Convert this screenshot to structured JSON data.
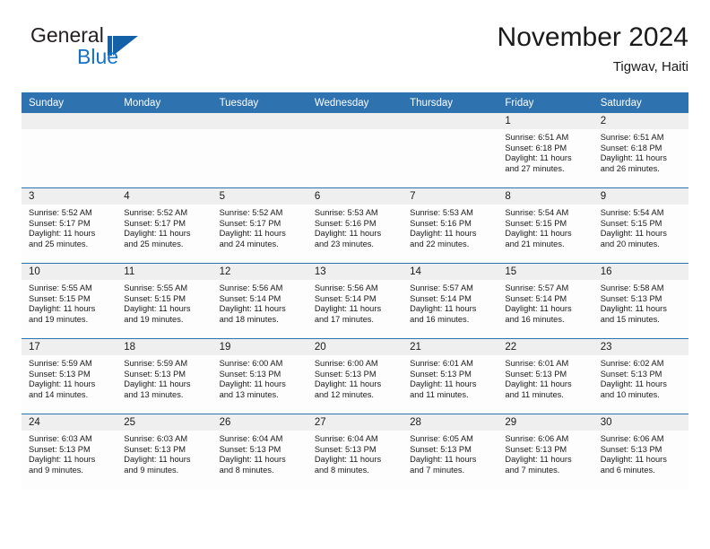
{
  "logo": {
    "text_top": "General",
    "text_bottom": "Blue",
    "mark": "blue-triangle-logo-icon",
    "color": "#1572c6"
  },
  "header": {
    "title": "November 2024",
    "subtitle": "Tigwav, Haiti"
  },
  "theme": {
    "header_blue": "#2e72b0",
    "daynum_band": "#efefef",
    "text": "#1a1a1a"
  },
  "calendar": {
    "weekday_headers": [
      "Sunday",
      "Monday",
      "Tuesday",
      "Wednesday",
      "Thursday",
      "Friday",
      "Saturday"
    ],
    "weeks": [
      [
        {
          "day": "",
          "lines": []
        },
        {
          "day": "",
          "lines": []
        },
        {
          "day": "",
          "lines": []
        },
        {
          "day": "",
          "lines": []
        },
        {
          "day": "",
          "lines": []
        },
        {
          "day": "1",
          "lines": [
            "Sunrise: 6:51 AM",
            "Sunset: 6:18 PM",
            "Daylight: 11 hours",
            "and 27 minutes."
          ]
        },
        {
          "day": "2",
          "lines": [
            "Sunrise: 6:51 AM",
            "Sunset: 6:18 PM",
            "Daylight: 11 hours",
            "and 26 minutes."
          ]
        }
      ],
      [
        {
          "day": "3",
          "lines": [
            "Sunrise: 5:52 AM",
            "Sunset: 5:17 PM",
            "Daylight: 11 hours",
            "and 25 minutes."
          ]
        },
        {
          "day": "4",
          "lines": [
            "Sunrise: 5:52 AM",
            "Sunset: 5:17 PM",
            "Daylight: 11 hours",
            "and 25 minutes."
          ]
        },
        {
          "day": "5",
          "lines": [
            "Sunrise: 5:52 AM",
            "Sunset: 5:17 PM",
            "Daylight: 11 hours",
            "and 24 minutes."
          ]
        },
        {
          "day": "6",
          "lines": [
            "Sunrise: 5:53 AM",
            "Sunset: 5:16 PM",
            "Daylight: 11 hours",
            "and 23 minutes."
          ]
        },
        {
          "day": "7",
          "lines": [
            "Sunrise: 5:53 AM",
            "Sunset: 5:16 PM",
            "Daylight: 11 hours",
            "and 22 minutes."
          ]
        },
        {
          "day": "8",
          "lines": [
            "Sunrise: 5:54 AM",
            "Sunset: 5:15 PM",
            "Daylight: 11 hours",
            "and 21 minutes."
          ]
        },
        {
          "day": "9",
          "lines": [
            "Sunrise: 5:54 AM",
            "Sunset: 5:15 PM",
            "Daylight: 11 hours",
            "and 20 minutes."
          ]
        }
      ],
      [
        {
          "day": "10",
          "lines": [
            "Sunrise: 5:55 AM",
            "Sunset: 5:15 PM",
            "Daylight: 11 hours",
            "and 19 minutes."
          ]
        },
        {
          "day": "11",
          "lines": [
            "Sunrise: 5:55 AM",
            "Sunset: 5:15 PM",
            "Daylight: 11 hours",
            "and 19 minutes."
          ]
        },
        {
          "day": "12",
          "lines": [
            "Sunrise: 5:56 AM",
            "Sunset: 5:14 PM",
            "Daylight: 11 hours",
            "and 18 minutes."
          ]
        },
        {
          "day": "13",
          "lines": [
            "Sunrise: 5:56 AM",
            "Sunset: 5:14 PM",
            "Daylight: 11 hours",
            "and 17 minutes."
          ]
        },
        {
          "day": "14",
          "lines": [
            "Sunrise: 5:57 AM",
            "Sunset: 5:14 PM",
            "Daylight: 11 hours",
            "and 16 minutes."
          ]
        },
        {
          "day": "15",
          "lines": [
            "Sunrise: 5:57 AM",
            "Sunset: 5:14 PM",
            "Daylight: 11 hours",
            "and 16 minutes."
          ]
        },
        {
          "day": "16",
          "lines": [
            "Sunrise: 5:58 AM",
            "Sunset: 5:13 PM",
            "Daylight: 11 hours",
            "and 15 minutes."
          ]
        }
      ],
      [
        {
          "day": "17",
          "lines": [
            "Sunrise: 5:59 AM",
            "Sunset: 5:13 PM",
            "Daylight: 11 hours",
            "and 14 minutes."
          ]
        },
        {
          "day": "18",
          "lines": [
            "Sunrise: 5:59 AM",
            "Sunset: 5:13 PM",
            "Daylight: 11 hours",
            "and 13 minutes."
          ]
        },
        {
          "day": "19",
          "lines": [
            "Sunrise: 6:00 AM",
            "Sunset: 5:13 PM",
            "Daylight: 11 hours",
            "and 13 minutes."
          ]
        },
        {
          "day": "20",
          "lines": [
            "Sunrise: 6:00 AM",
            "Sunset: 5:13 PM",
            "Daylight: 11 hours",
            "and 12 minutes."
          ]
        },
        {
          "day": "21",
          "lines": [
            "Sunrise: 6:01 AM",
            "Sunset: 5:13 PM",
            "Daylight: 11 hours",
            "and 11 minutes."
          ]
        },
        {
          "day": "22",
          "lines": [
            "Sunrise: 6:01 AM",
            "Sunset: 5:13 PM",
            "Daylight: 11 hours",
            "and 11 minutes."
          ]
        },
        {
          "day": "23",
          "lines": [
            "Sunrise: 6:02 AM",
            "Sunset: 5:13 PM",
            "Daylight: 11 hours",
            "and 10 minutes."
          ]
        }
      ],
      [
        {
          "day": "24",
          "lines": [
            "Sunrise: 6:03 AM",
            "Sunset: 5:13 PM",
            "Daylight: 11 hours",
            "and 9 minutes."
          ]
        },
        {
          "day": "25",
          "lines": [
            "Sunrise: 6:03 AM",
            "Sunset: 5:13 PM",
            "Daylight: 11 hours",
            "and 9 minutes."
          ]
        },
        {
          "day": "26",
          "lines": [
            "Sunrise: 6:04 AM",
            "Sunset: 5:13 PM",
            "Daylight: 11 hours",
            "and 8 minutes."
          ]
        },
        {
          "day": "27",
          "lines": [
            "Sunrise: 6:04 AM",
            "Sunset: 5:13 PM",
            "Daylight: 11 hours",
            "and 8 minutes."
          ]
        },
        {
          "day": "28",
          "lines": [
            "Sunrise: 6:05 AM",
            "Sunset: 5:13 PM",
            "Daylight: 11 hours",
            "and 7 minutes."
          ]
        },
        {
          "day": "29",
          "lines": [
            "Sunrise: 6:06 AM",
            "Sunset: 5:13 PM",
            "Daylight: 11 hours",
            "and 7 minutes."
          ]
        },
        {
          "day": "30",
          "lines": [
            "Sunrise: 6:06 AM",
            "Sunset: 5:13 PM",
            "Daylight: 11 hours",
            "and 6 minutes."
          ]
        }
      ]
    ]
  }
}
